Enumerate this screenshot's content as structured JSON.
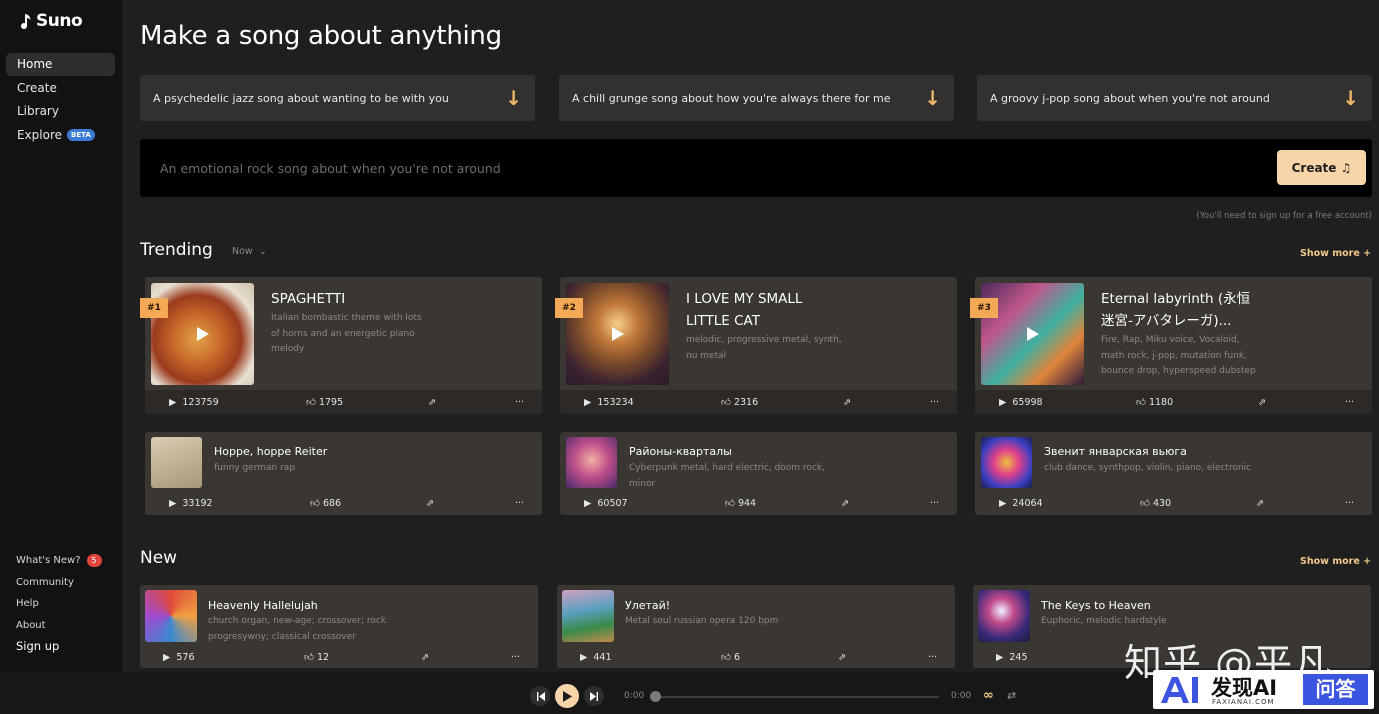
{
  "brand": {
    "name": "Suno"
  },
  "sidebar": {
    "items": [
      {
        "label": "Home"
      },
      {
        "label": "Create"
      },
      {
        "label": "Library"
      },
      {
        "label": "Explore",
        "badge": "BETA"
      }
    ],
    "bottom": {
      "whats_new": "What's New?",
      "whats_new_count": "5",
      "community": "Community",
      "help": "Help",
      "about": "About",
      "signup": "Sign up"
    }
  },
  "main": {
    "heading": "Make a song about anything",
    "prompts": [
      "A psychedelic jazz song about wanting to be with you",
      "A chill grunge song about how you're always there for me",
      "A groovy j-pop song about when you're not around"
    ],
    "create_placeholder": "An emotional rock song about when you're not around",
    "create_button": "Create",
    "signup_note": "(You'll need to sign up for a free account)"
  },
  "trending": {
    "title": "Trending",
    "filter": "Now",
    "show_more": "Show more +",
    "featured": [
      {
        "rank": "#1",
        "title_lines": [
          "SPAGHETTI"
        ],
        "tags": [
          "Italian bombastic theme with lots",
          "of horns and an energetic piano",
          "melody"
        ],
        "plays": "123759",
        "likes": "1795"
      },
      {
        "rank": "#2",
        "title_lines": [
          "I LOVE MY SMALL",
          "LITTLE CAT"
        ],
        "tags": [
          "melodic, progressive metal, synth,",
          "nu metal"
        ],
        "plays": "153234",
        "likes": "2316"
      },
      {
        "rank": "#3",
        "title_lines": [
          "Eternal labyrinth (永恒",
          "迷宮-アバタレーガ)..."
        ],
        "tags": [
          "Fire, Rap, Miku voice, Vocaloid,",
          "math rock, j-pop, mutation funk,",
          "bounce drop, hyperspeed dubstep"
        ],
        "plays": "65998",
        "likes": "1180"
      }
    ],
    "small": [
      {
        "title": "Hoppe, hoppe Reiter",
        "tags": [
          "funny german rap"
        ],
        "plays": "33192",
        "likes": "686"
      },
      {
        "title": "Районы-кварталы",
        "tags": [
          "Cyberpunk metal, hard electric, doom rock,",
          "minor"
        ],
        "plays": "60507",
        "likes": "944"
      },
      {
        "title": "Звенит январская вьюга",
        "tags": [
          "club dance, synthpop, violin, piano, electronic"
        ],
        "plays": "24064",
        "likes": "430"
      }
    ]
  },
  "new_section": {
    "title": "New",
    "show_more": "Show more +",
    "items": [
      {
        "title": "Heavenly Hallelujah",
        "tags": [
          "church organ, new-age; crossover; rock",
          "progresywny; classical crossover"
        ],
        "plays": "576",
        "likes": "12"
      },
      {
        "title": "Улетай!",
        "tags": [
          "Metal soul russian opera 120 bpm"
        ],
        "plays": "441",
        "likes": "6"
      },
      {
        "title": "The Keys to Heaven",
        "tags": [
          "Euphoric, melodic hardstyle"
        ],
        "plays": "245",
        "likes": ""
      }
    ]
  },
  "player": {
    "time_start": "0:00",
    "time_end": "0:00"
  },
  "watermark": {
    "zhihu": "知乎 @平凡",
    "site_cn": "发现AI",
    "site_en": "FAXIANAI.COM",
    "qa": "问答"
  },
  "colors": {
    "accent": "#f7d5a9",
    "rank": "#f3a956",
    "card": "#3a3632"
  }
}
